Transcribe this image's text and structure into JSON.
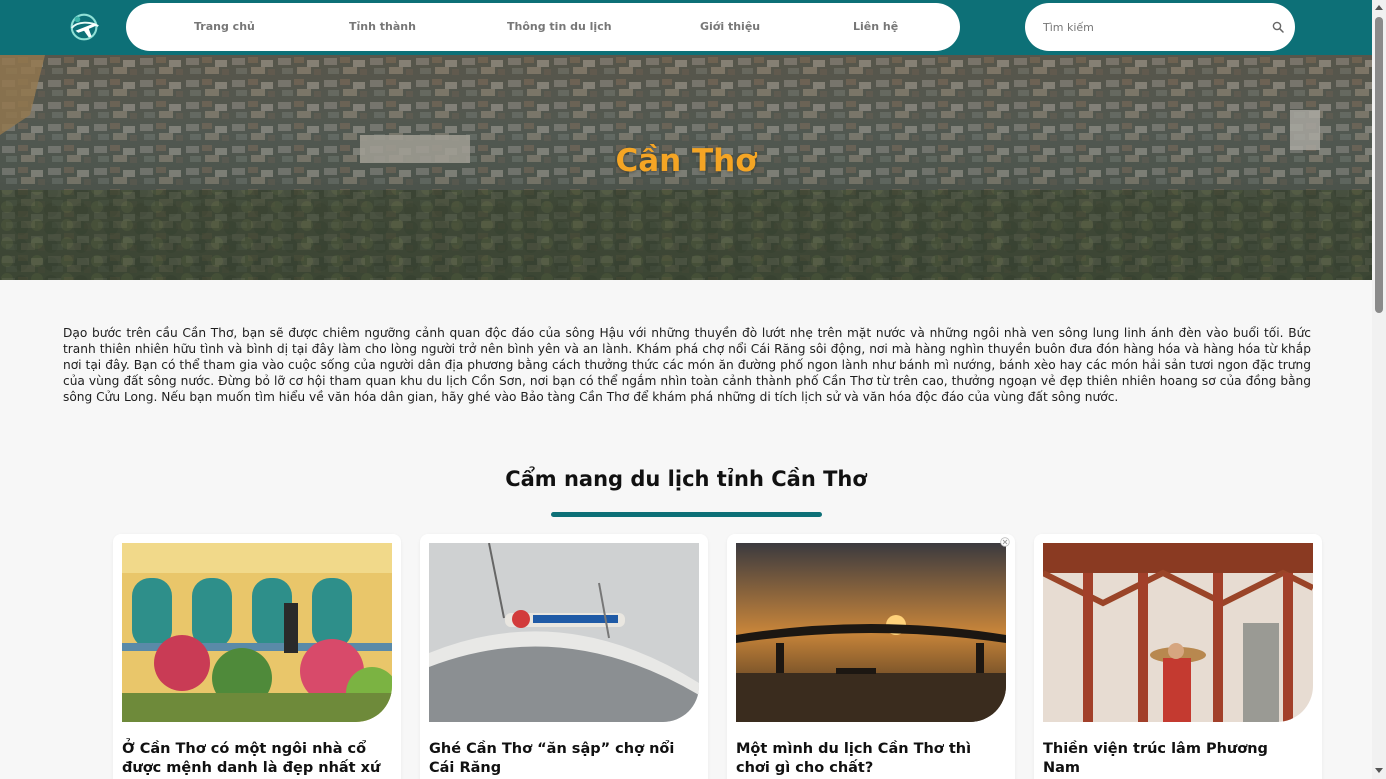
{
  "nav": {
    "items": [
      {
        "label": "Trang chủ"
      },
      {
        "label": "Tỉnh thành"
      },
      {
        "label": "Thông tin du lịch"
      },
      {
        "label": "Giới thiệu"
      },
      {
        "label": "Liên hệ"
      }
    ]
  },
  "search": {
    "placeholder": "Tìm kiếm",
    "icon": "search-icon"
  },
  "hero": {
    "title": "Cần Thơ"
  },
  "intro": {
    "text": "Dạo bước trên cầu Cần Thơ, bạn sẽ được chiêm ngưỡng cảnh quan độc đáo của sông Hậu với những thuyền đò lướt nhẹ trên mặt nước và những ngôi nhà ven sông lung linh ánh đèn vào buổi tối. Bức tranh thiên nhiên hữu tình và bình dị tại đây làm cho lòng người trở nên bình yên và an lành. Khám phá chợ nổi Cái Răng sôi động, nơi mà hàng nghìn thuyền buôn đưa đón hàng hóa và hàng hóa từ khắp nơi tại đây. Bạn có thể tham gia vào cuộc sống của người dân địa phương bằng cách thưởng thức các món ăn đường phố ngon lành như bánh mì nướng, bánh xèo hay các món hải sản tươi ngon đặc trưng của vùng đất sông nước. Đừng bỏ lỡ cơ hội tham quan khu du lịch Cồn Sơn, nơi bạn có thể ngắm nhìn toàn cảnh thành phố Cần Thơ từ trên cao, thưởng ngoạn vẻ đẹp thiên nhiên hoang sơ của đồng bằng sông Cửu Long. Nếu bạn muốn tìm hiểu về văn hóa dân gian, hãy ghé vào Bảo tàng Cần Thơ để khám phá những di tích lịch sử và văn hóa độc đáo của vùng đất sông nước."
  },
  "guide": {
    "title": "Cẩm nang du lịch tỉnh Cần Thơ",
    "cards": [
      {
        "title": "Ở Cần Thơ có một ngôi nhà cổ được mệnh danh là đẹp nhất xứ"
      },
      {
        "title": "Ghé Cần Thơ “ăn sập” chợ nổi Cái Răng"
      },
      {
        "title": "Một mình du lịch Cần Thơ thì chơi gì cho chất?"
      },
      {
        "title": "Thiền viện trúc lâm Phương Nam"
      }
    ]
  },
  "colors": {
    "header": "#0d7077",
    "hero_title": "#f5a524",
    "accent_bar": "#0d7077"
  }
}
